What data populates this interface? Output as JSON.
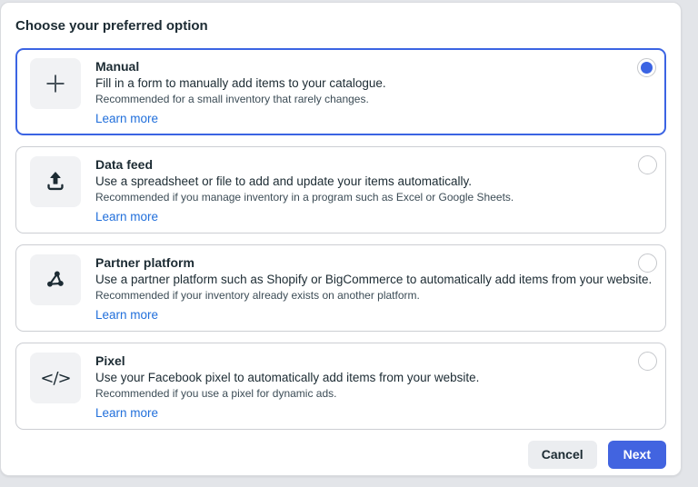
{
  "header": {
    "title": "Choose your preferred option"
  },
  "options": [
    {
      "icon": "plus-icon",
      "title": "Manual",
      "description": "Fill in a form to manually add items to your catalogue.",
      "recommendation": "Recommended for a small inventory that rarely changes.",
      "link": "Learn more",
      "selected": true
    },
    {
      "icon": "upload-icon",
      "title": "Data feed",
      "description": "Use a spreadsheet or file to add and update your items automatically.",
      "recommendation": "Recommended if you manage inventory in a program such as Excel or Google Sheets.",
      "link": "Learn more",
      "selected": false
    },
    {
      "icon": "partner-network-icon",
      "title": "Partner platform",
      "description": "Use a partner platform such as Shopify or BigCommerce to automatically add items from your website.",
      "recommendation": "Recommended if your inventory already exists on another platform.",
      "link": "Learn more",
      "selected": false
    },
    {
      "icon": "code-icon",
      "title": "Pixel",
      "description": "Use your Facebook pixel to automatically add items from your website.",
      "recommendation": "Recommended if you use a pixel for dynamic ads.",
      "link": "Learn more",
      "selected": false
    }
  ],
  "icons": {
    "code_glyph": "</>"
  },
  "footer": {
    "cancel_label": "Cancel",
    "next_label": "Next"
  },
  "colors": {
    "accent": "#3b64e3",
    "link_blue": "#216fdb",
    "next_button": "#4264e0",
    "page_background": "#e3e5e9"
  }
}
